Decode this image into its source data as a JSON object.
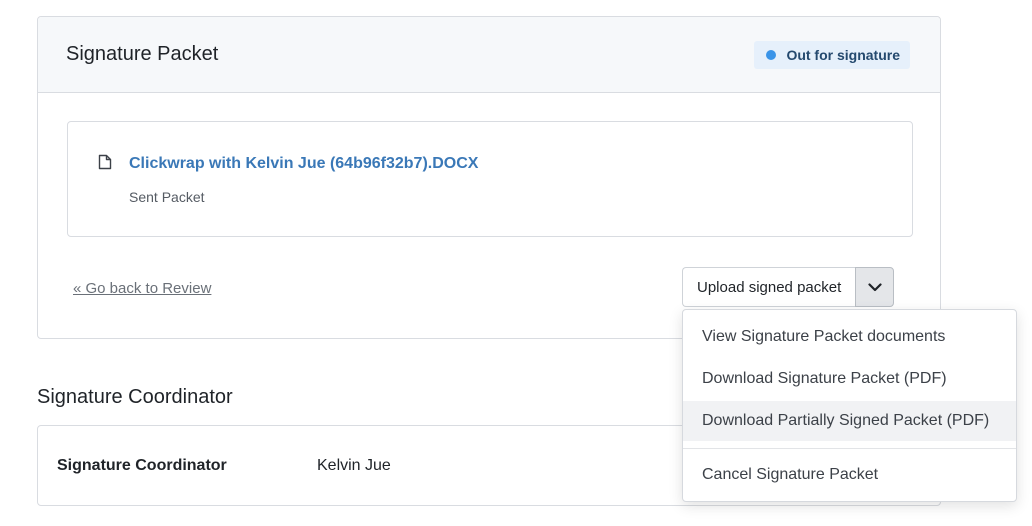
{
  "packet": {
    "title": "Signature Packet",
    "status": {
      "label": "Out for signature",
      "dot_color": "#3a94e8"
    },
    "document": {
      "icon": "file-icon",
      "name": "Clickwrap with Kelvin Jue (64b96f32b7).DOCX",
      "subtitle": "Sent Packet"
    },
    "back_link": "« Go back to Review",
    "upload_button": "Upload signed packet",
    "upload_caret_icon": "chevron-down-icon"
  },
  "menu": {
    "items": [
      "View Signature Packet documents",
      "Download Signature Packet (PDF)",
      "Download Partially Signed Packet (PDF)",
      "Cancel Signature Packet"
    ],
    "highlighted_item": "Download Partially Signed Packet (PDF)"
  },
  "coordinator": {
    "section_title": "Signature Coordinator",
    "label": "Signature Coordinator",
    "value": "Kelvin Jue"
  },
  "colors": {
    "link": "#3a78b7",
    "badge_bg": "#e6f0fb",
    "header_bg": "#f6f8fa"
  }
}
